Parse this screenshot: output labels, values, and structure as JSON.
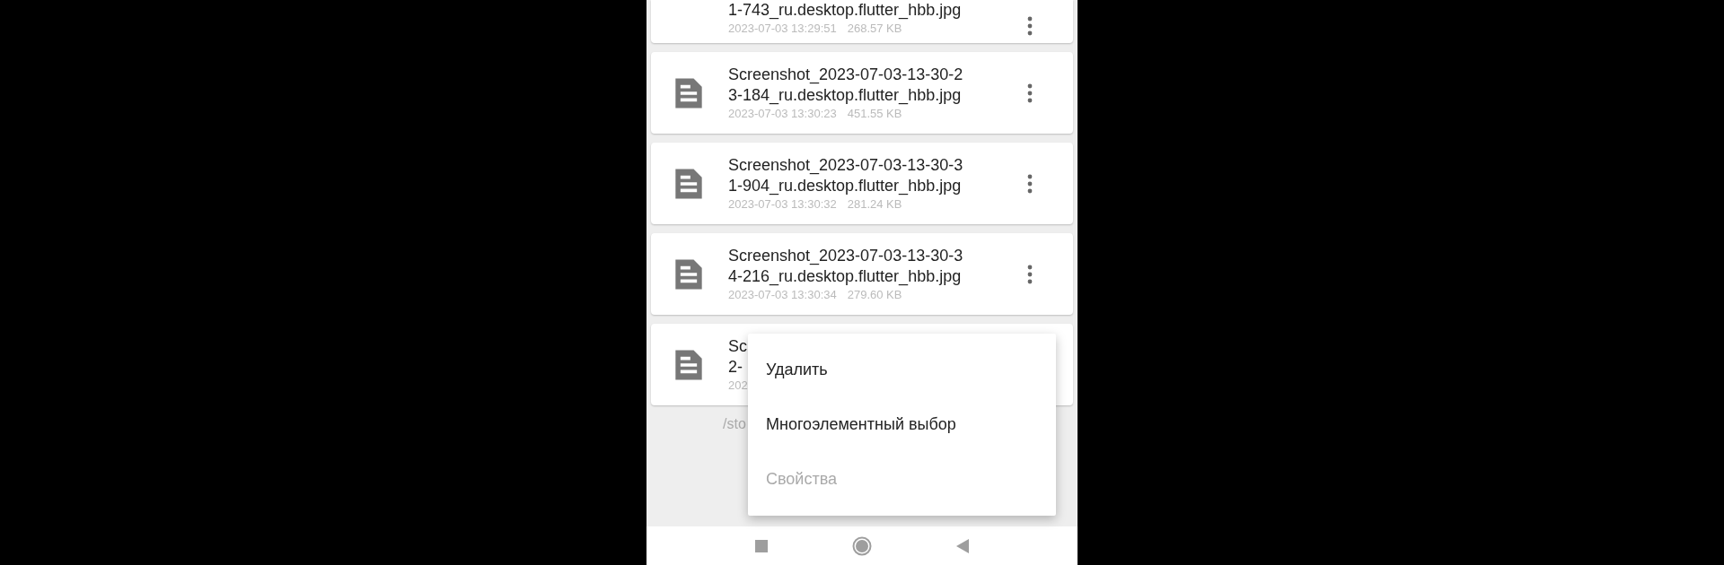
{
  "files": [
    {
      "title_lines": [
        "1-743_ru.desktop.flutter_hbb.jpg"
      ],
      "date": "2023-07-03 13:29:51",
      "size": "268.57 KB"
    },
    {
      "title_lines": [
        "Screenshot_2023-07-03-13-30-2",
        "3-184_ru.desktop.flutter_hbb.jpg"
      ],
      "date": "2023-07-03 13:30:23",
      "size": "451.55 KB"
    },
    {
      "title_lines": [
        "Screenshot_2023-07-03-13-30-3",
        "1-904_ru.desktop.flutter_hbb.jpg"
      ],
      "date": "2023-07-03 13:30:32",
      "size": "281.24 KB"
    },
    {
      "title_lines": [
        "Screenshot_2023-07-03-13-30-3",
        "4-216_ru.desktop.flutter_hbb.jpg"
      ],
      "date": "2023-07-03 13:30:34",
      "size": "279.60 KB"
    },
    {
      "title_lines": [
        "Sc",
        "2-"
      ],
      "date": "202"
    }
  ],
  "path": "/sto",
  "context_menu": [
    {
      "label": "Удалить",
      "disabled": false
    },
    {
      "label": "Многоэлементный выбор",
      "disabled": false
    },
    {
      "label": "Свойства",
      "disabled": true
    }
  ]
}
